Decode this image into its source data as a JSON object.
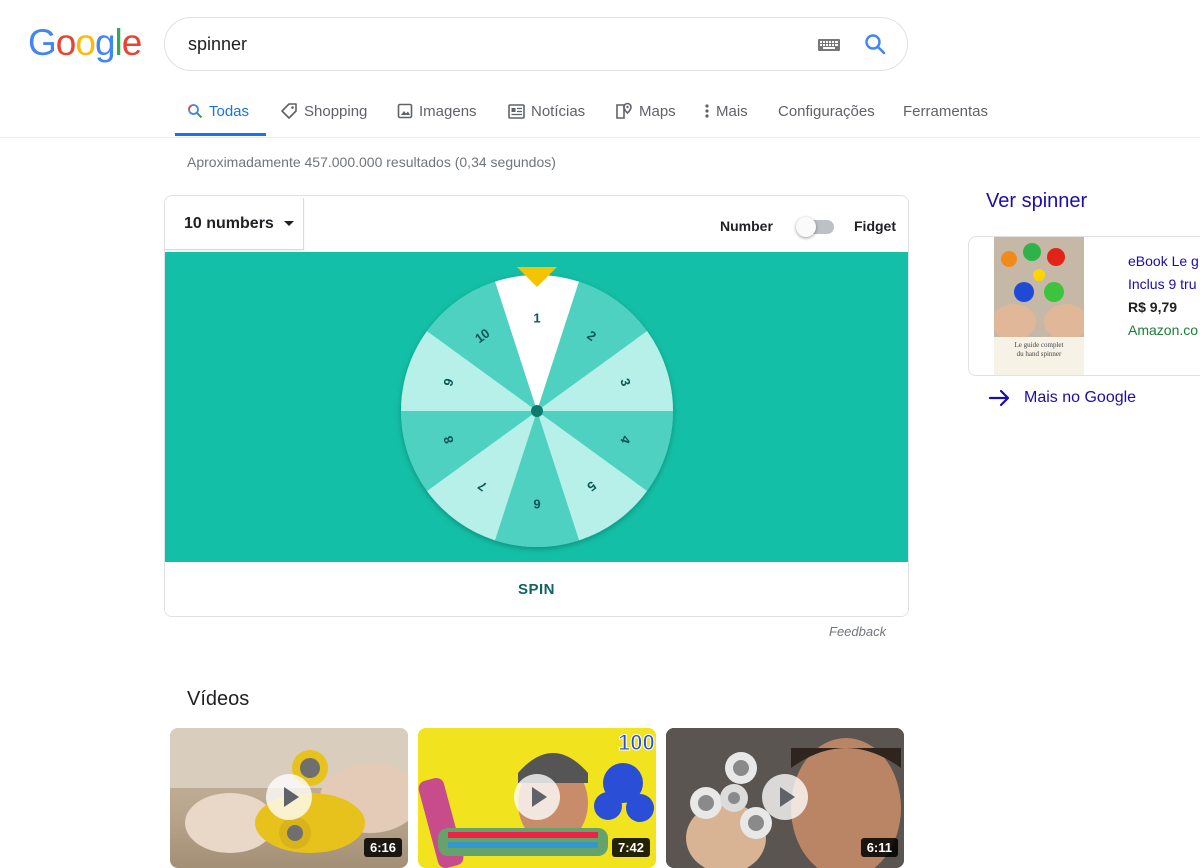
{
  "header": {
    "logo_letters": [
      {
        "ch": "G",
        "color": "#4285F4"
      },
      {
        "ch": "o",
        "color": "#EA4335"
      },
      {
        "ch": "o",
        "color": "#FBBC05"
      },
      {
        "ch": "g",
        "color": "#4285F4"
      },
      {
        "ch": "l",
        "color": "#34A853"
      },
      {
        "ch": "e",
        "color": "#EA4335"
      }
    ],
    "search_value": "spinner",
    "keyboard_icon": "keyboard-icon",
    "search_icon": "search-icon"
  },
  "tabs": [
    {
      "label": "Todas",
      "icon": "search-icon",
      "active": true
    },
    {
      "label": "Shopping",
      "icon": "tag-icon"
    },
    {
      "label": "Imagens",
      "icon": "image-icon"
    },
    {
      "label": "Notícias",
      "icon": "news-icon"
    },
    {
      "label": "Maps",
      "icon": "map-pin-icon"
    },
    {
      "label": "Mais",
      "icon": "more-vert-icon"
    },
    {
      "label": "Configurações"
    },
    {
      "label": "Ferramentas"
    }
  ],
  "result_stats": "Aproximadamente 457.000.000 resultados (0,34 segundos)",
  "spinner": {
    "dropdown_label": "10 numbers",
    "mode_left": "Number",
    "mode_right": "Fidget",
    "toggle_on": false,
    "numbers": [
      "1",
      "2",
      "3",
      "4",
      "5",
      "6",
      "7",
      "8",
      "9",
      "10"
    ],
    "spin_label": "SPIN",
    "colors": {
      "background": "#13bfa6",
      "segment_dark": "#4fd1c1",
      "segment_light": "#b6f0e8",
      "segment_selected": "#ffffff",
      "pointer": "#f5c400",
      "text": "#0e5757"
    }
  },
  "feedback": "Feedback",
  "videos": {
    "title": "Vídeos",
    "items": [
      {
        "duration": "6:16"
      },
      {
        "duration": "7:42"
      },
      {
        "duration": "6:11"
      }
    ]
  },
  "side_panel": {
    "title": "Ver spinner",
    "product": {
      "title_line1": "eBook Le g",
      "title_line2": "Inclus 9 tru",
      "price": "R$ 9,79",
      "store": "Amazon.co",
      "cover_text1": "Le guide complet",
      "cover_text2": "du hand spinner"
    },
    "more_link": "Mais no Google"
  }
}
